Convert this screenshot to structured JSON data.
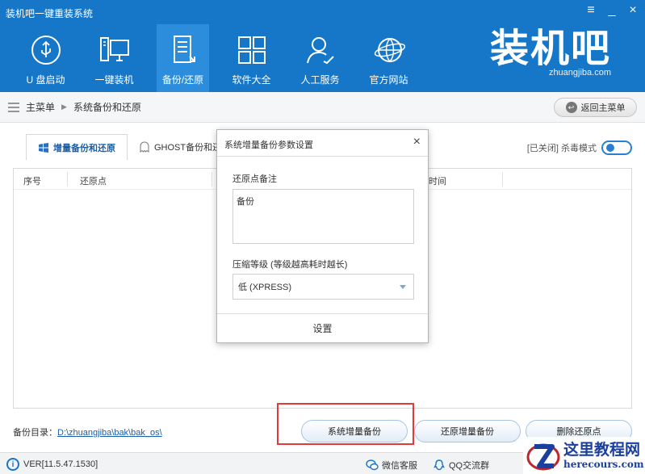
{
  "window": {
    "title": "装机吧一键重装系统",
    "controls": {
      "menu": "≡",
      "minimize": "_",
      "close": "×"
    }
  },
  "nav": {
    "items": [
      {
        "label": "U 盘启动",
        "icon": "usb-icon"
      },
      {
        "label": "一键装机",
        "icon": "monitor-icon"
      },
      {
        "label": "备份/还原",
        "icon": "document-icon",
        "active": true
      },
      {
        "label": "软件大全",
        "icon": "grid-icon"
      },
      {
        "label": "人工服务",
        "icon": "person-icon"
      },
      {
        "label": "官方网站",
        "icon": "globe-icon"
      }
    ]
  },
  "brand": {
    "logo": "装机吧",
    "url": "zhuangjiba.com"
  },
  "breadcrumb": {
    "home": "主菜单",
    "current": "系统备份和还原",
    "back_label": "返回主菜单"
  },
  "tabs": [
    {
      "label": "增量备份和还原",
      "active": true
    },
    {
      "label": "GHOST备份和还"
    }
  ],
  "antivirus": {
    "label": "[已关闭] 杀毒模式",
    "enabled": false
  },
  "table": {
    "columns": [
      "序号",
      "还原点",
      "时间"
    ]
  },
  "dialog": {
    "title": "系统增量备份参数设置",
    "close": "×",
    "note_label": "还原点备注",
    "note_value": "备份",
    "level_label": "压缩等级 (等级越高耗时越长)",
    "level_value": "低 (XPRESS)",
    "confirm_label": "设置"
  },
  "footer": {
    "backup_dir_label": "备份目录：",
    "backup_dir_path": "D:\\zhuangjiba\\bak\\bak_os\\",
    "buttons": [
      "系统增量备份",
      "还原增量备份",
      "删除还原点"
    ]
  },
  "status": {
    "version": "VER[11.5.47.1530]",
    "wechat": "微信客服",
    "qq": "QQ交流群"
  },
  "watermark": {
    "cn": "这里教程网",
    "en": "herecours.com"
  },
  "colors": {
    "header": "#1677c9",
    "accent": "#1a5ea8",
    "highlight": "#e23a3a"
  }
}
